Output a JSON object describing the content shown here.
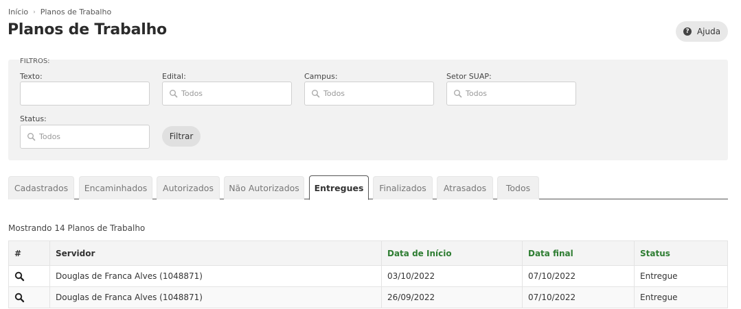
{
  "breadcrumb": {
    "home": "Início",
    "current": "Planos de Trabalho"
  },
  "page_title": "Planos de Trabalho",
  "help_button": "Ajuda",
  "filters": {
    "title": "FILTROS:",
    "texto": {
      "label": "Texto:",
      "value": ""
    },
    "edital": {
      "label": "Edital:",
      "placeholder": "Todos"
    },
    "campus": {
      "label": "Campus:",
      "placeholder": "Todos"
    },
    "setor": {
      "label": "Setor SUAP:",
      "placeholder": "Todos"
    },
    "status": {
      "label": "Status:",
      "placeholder": "Todos"
    },
    "button": "Filtrar"
  },
  "tabs": [
    {
      "label": "Cadastrados"
    },
    {
      "label": "Encaminhados"
    },
    {
      "label": "Autorizados"
    },
    {
      "label": "Não Autorizados"
    },
    {
      "label": "Entregues",
      "active": true
    },
    {
      "label": "Finalizados"
    },
    {
      "label": "Atrasados"
    },
    {
      "label": "Todos"
    }
  ],
  "showing_text": "Mostrando 14 Planos de Trabalho",
  "table": {
    "headers": [
      "#",
      "Servidor",
      "Data de Início",
      "Data final",
      "Status"
    ],
    "rows": [
      {
        "servidor": "Douglas de Franca Alves (1048871)",
        "inicio": "03/10/2022",
        "final": "07/10/2022",
        "status": "Entregue"
      },
      {
        "servidor": "Douglas de Franca Alves (1048871)",
        "inicio": "26/09/2022",
        "final": "07/10/2022",
        "status": "Entregue"
      }
    ]
  },
  "colors": {
    "sorted_header": "#2e7d32",
    "filter_bg": "#f2f2f2"
  }
}
